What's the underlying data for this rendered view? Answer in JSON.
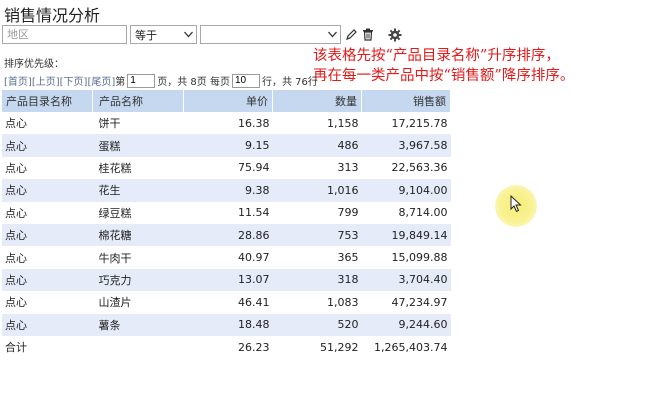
{
  "title": "销售情况分析",
  "filters": {
    "region_placeholder": "地区",
    "operator": "等于",
    "value": ""
  },
  "note_lines": [
    "该表格先按“产品目录名称”升序排序，",
    "再在每一类产品中按“销售额”降序排序。"
  ],
  "sort_label": "排序优先级：",
  "pager": {
    "first": "[首页]",
    "prev": "[上页]",
    "next": "[下页]",
    "last": "[尾页]",
    "page_prefix": "第",
    "page_value": "1",
    "page_suffix": "页，共 8页 每页",
    "size_value": "10",
    "size_suffix": "行，共 76行"
  },
  "table": {
    "headers": [
      "产品目录名称",
      "产品名称",
      "单价",
      "数量",
      "销售额"
    ],
    "rows": [
      [
        "点心",
        "饼干",
        "16.38",
        "1,158",
        "17,215.78"
      ],
      [
        "点心",
        "蛋糕",
        "9.15",
        "486",
        "3,967.58"
      ],
      [
        "点心",
        "桂花糕",
        "75.94",
        "313",
        "22,563.36"
      ],
      [
        "点心",
        "花生",
        "9.38",
        "1,016",
        "9,104.00"
      ],
      [
        "点心",
        "绿豆糕",
        "11.54",
        "799",
        "8,714.00"
      ],
      [
        "点心",
        "棉花糖",
        "28.86",
        "753",
        "19,849.14"
      ],
      [
        "点心",
        "牛肉干",
        "40.97",
        "365",
        "15,099.88"
      ],
      [
        "点心",
        "巧克力",
        "13.07",
        "318",
        "3,704.40"
      ],
      [
        "点心",
        "山渣片",
        "46.41",
        "1,083",
        "47,234.97"
      ],
      [
        "点心",
        "薯条",
        "18.48",
        "520",
        "9,244.60"
      ]
    ],
    "total": [
      "合计",
      "",
      "26.23",
      "51,292",
      "1,265,403.74"
    ]
  },
  "colors": {
    "header_bg": "#c5d8ef",
    "stripe_bg": "#e6ebfa",
    "note": "#e21a1a",
    "link": "#5a6f95"
  },
  "icons": [
    "pencil-icon",
    "trash-icon",
    "gear-icon",
    "chevron-down-icon",
    "mouse-pointer-icon"
  ]
}
